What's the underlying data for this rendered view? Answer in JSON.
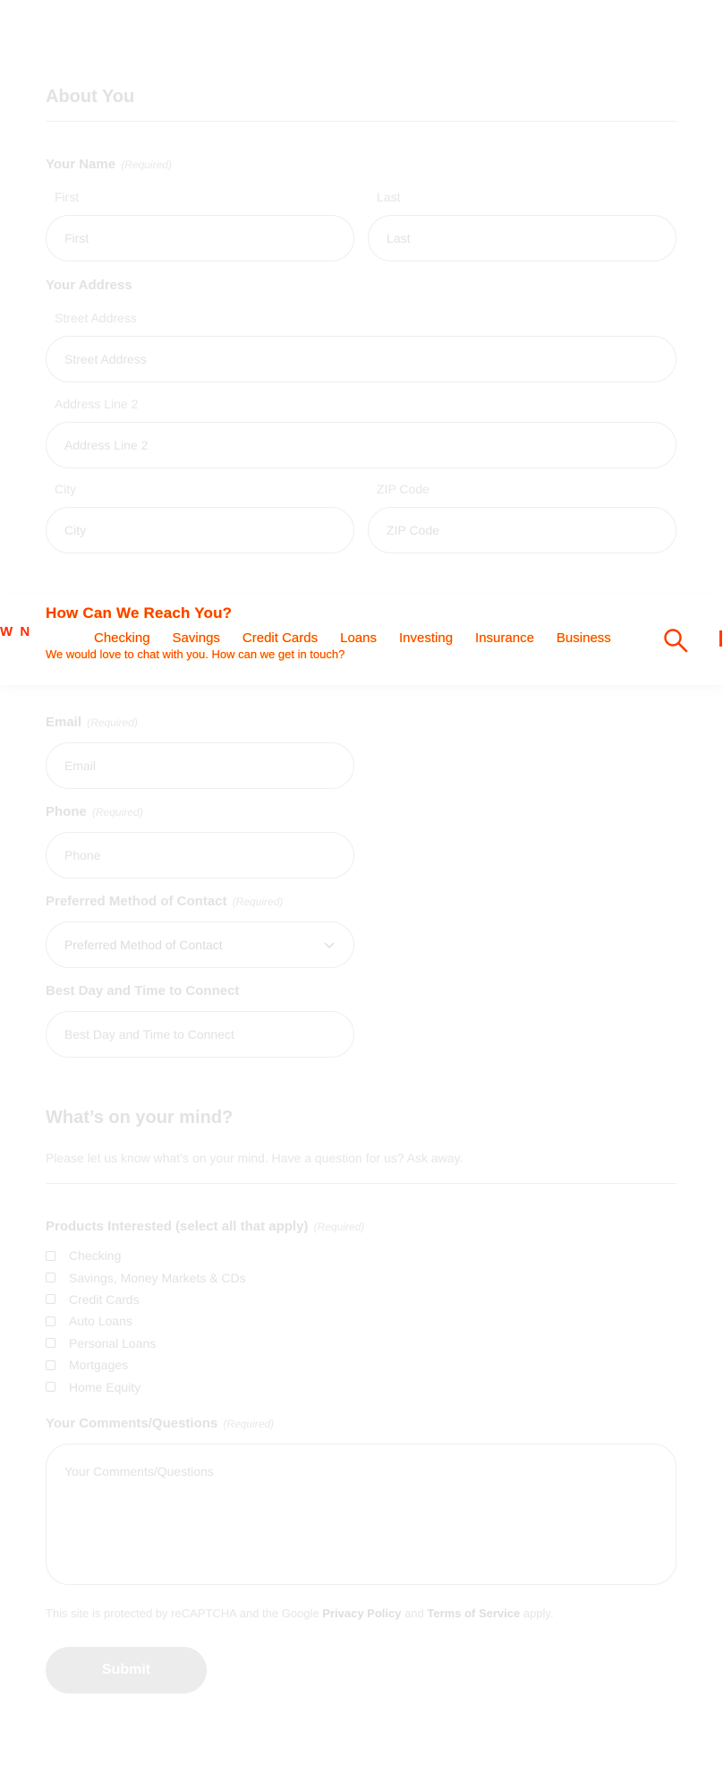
{
  "about": {
    "title": "About You",
    "name": {
      "label": "Your Name",
      "required": "(Required)",
      "first_label": "First",
      "first_placeholder": "First",
      "last_label": "Last",
      "last_placeholder": "Last"
    },
    "address": {
      "label": "Your Address",
      "street_label": "Street Address",
      "street_placeholder": "Street Address",
      "line2_label": "Address Line 2",
      "line2_placeholder": "Address Line 2",
      "city_label": "City",
      "city_placeholder": "City",
      "zip_label": "ZIP Code",
      "zip_placeholder": "ZIP Code"
    }
  },
  "header": {
    "logo_text": "W N",
    "nav": [
      "Checking",
      "Savings",
      "Credit Cards",
      "Loans",
      "Investing",
      "Insurance",
      "Business"
    ],
    "accent": "#ff3b00"
  },
  "reach": {
    "title": "How Can We Reach You?",
    "subtitle": "We would love to chat with you. How can we get in touch?",
    "email": {
      "label": "Email",
      "required": "(Required)",
      "placeholder": "Email"
    },
    "phone": {
      "label": "Phone",
      "required": "(Required)",
      "placeholder": "Phone"
    },
    "method": {
      "label": "Preferred Method of Contact",
      "required": "(Required)",
      "value": "Preferred Method of Contact"
    },
    "besttime": {
      "label": "Best Day and Time to Connect",
      "placeholder": "Best Day and Time to Connect"
    }
  },
  "mind": {
    "title": "What’s on your mind?",
    "subtitle": "Please let us know what’s on your mind. Have a question for us? Ask away.",
    "products": {
      "label": "Products Interested (select all that apply)",
      "required": "(Required)",
      "options": [
        "Checking",
        "Savings, Money Markets & CDs",
        "Credit Cards",
        "Auto Loans",
        "Personal Loans",
        "Mortgages",
        "Home Equity"
      ]
    },
    "comments": {
      "label": "Your Comments/Questions",
      "required": "(Required)",
      "placeholder": "Your Comments/Questions"
    }
  },
  "recaptcha": {
    "prefix": "This site is protected by reCAPTCHA and the Google",
    "privacy": "Privacy Policy",
    "and": "and",
    "terms": "Terms of Service",
    "suffix": "apply."
  },
  "submit_label": "Submit"
}
